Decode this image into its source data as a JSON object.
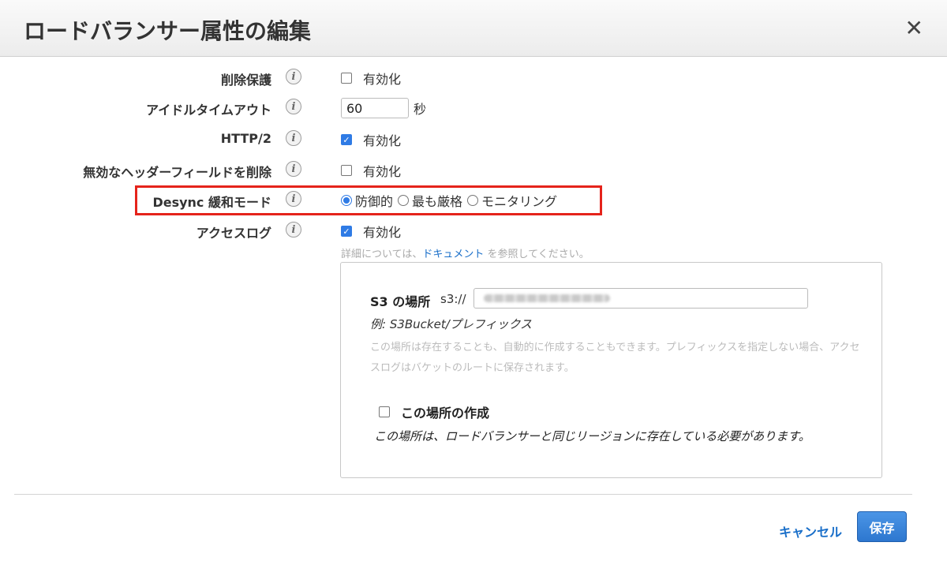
{
  "dialog": {
    "title": "ロードバランサー属性の編集",
    "close_glyph": "✕"
  },
  "attributes": {
    "deletion_protection": {
      "label": "削除保護",
      "checkbox_label": "有効化",
      "checked": false
    },
    "idle_timeout": {
      "label": "アイドルタイムアウト",
      "value": "60",
      "unit": "秒"
    },
    "http2": {
      "label": "HTTP/2",
      "checkbox_label": "有効化",
      "checked": true
    },
    "drop_invalid_headers": {
      "label": "無効なヘッダーフィールドを削除",
      "checkbox_label": "有効化",
      "checked": false
    },
    "desync_mode": {
      "label": "Desync 緩和モード",
      "options": [
        "防御的",
        "最も厳格",
        "モニタリング"
      ],
      "selected": "防御的"
    },
    "access_logs": {
      "label": "アクセスログ",
      "checkbox_label": "有効化",
      "checked": true
    }
  },
  "docs": {
    "prefix": "詳細については、",
    "link": "ドキュメント",
    "suffix": " を参照してください。"
  },
  "s3": {
    "label": "S3 の場所",
    "prefix": "s3://",
    "example": "例: S3Bucket/プレフィックス",
    "help": "この場所は存在することも、自動的に作成することもできます。プレフィックスを指定しない場合、アクセスログはバケットのルートに保存されます。",
    "create_label": "この場所の作成",
    "create_checked": false,
    "create_note": "この場所は、ロードバランサーと同じリージョンに存在している必要があります。"
  },
  "footer": {
    "cancel_label": "キャンセル",
    "save_label": "保存"
  },
  "colors": {
    "accent": "#2f7be5",
    "highlight": "#e5231b",
    "link": "#1a6fc9"
  },
  "icons": {
    "info": "info-icon",
    "close": "close-icon"
  }
}
